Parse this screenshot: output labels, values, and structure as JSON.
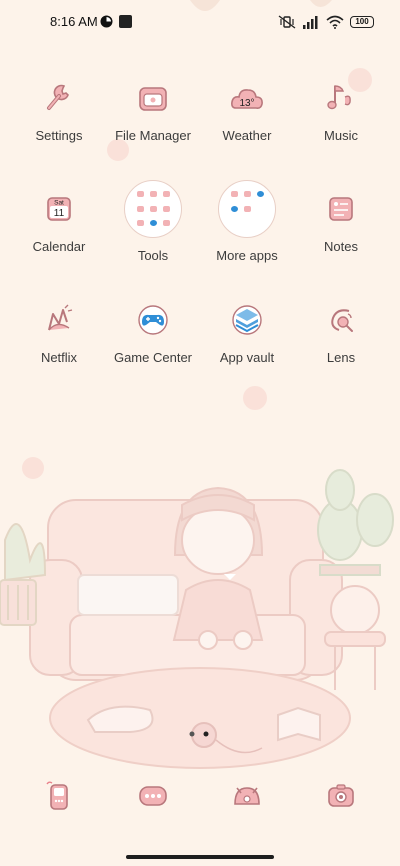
{
  "status_bar": {
    "time": "8:16 AM",
    "battery": "100"
  },
  "apps": [
    {
      "label": "Settings",
      "icon": "wrench-icon"
    },
    {
      "label": "File Manager",
      "icon": "folder-icon"
    },
    {
      "label": "Weather",
      "icon": "weather-cloud-icon",
      "badge": "13°"
    },
    {
      "label": "Music",
      "icon": "music-note-icon"
    },
    {
      "label": "Calendar",
      "icon": "calendar-icon",
      "day": "Sat",
      "date": "11"
    },
    {
      "label": "Tools",
      "icon": "folder-tools-icon"
    },
    {
      "label": "More apps",
      "icon": "folder-more-apps-icon"
    },
    {
      "label": "Notes",
      "icon": "notes-icon"
    },
    {
      "label": "Netflix",
      "icon": "netflix-icon"
    },
    {
      "label": "Game Center",
      "icon": "gamepad-icon"
    },
    {
      "label": "App vault",
      "icon": "app-vault-icon"
    },
    {
      "label": "Lens",
      "icon": "lens-icon"
    }
  ],
  "dock": [
    {
      "icon": "phone-icon"
    },
    {
      "icon": "messages-icon"
    },
    {
      "icon": "browser-icon"
    },
    {
      "icon": "camera-icon"
    }
  ],
  "colors": {
    "wallpaper": "#fdf3ea",
    "icon_pink": "#e9a2a5",
    "icon_stroke": "#b8777c",
    "accent_blue": "#2f8ed6"
  }
}
